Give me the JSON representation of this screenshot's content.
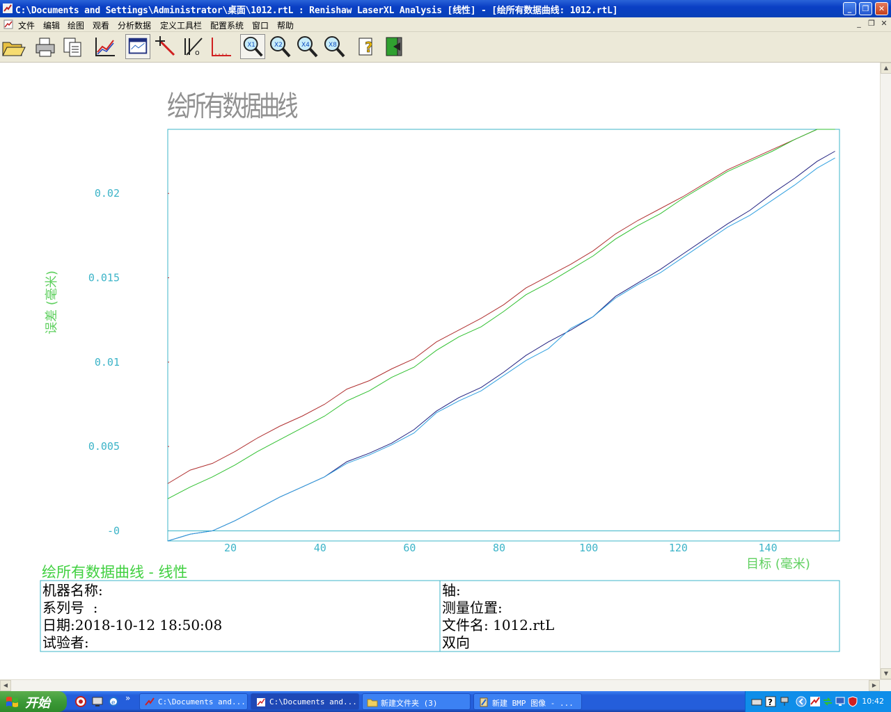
{
  "window": {
    "title": "C:\\Documents and Settings\\Administrator\\桌面\\1012.rtL : Renishaw LaserXL Analysis [线性] - [绘所有数据曲线: 1012.rtL]",
    "minimize": "_",
    "maximize": "❐",
    "close": "✕"
  },
  "menu": {
    "items": [
      "文件",
      "编辑",
      "绘图",
      "观看",
      "分析数据",
      "定义工具栏",
      "配置系统",
      "窗口",
      "帮助"
    ],
    "mdi_min": "_",
    "mdi_restore": "❐",
    "mdi_close": "✕"
  },
  "toolbar": {
    "buttons": [
      "open-icon",
      "print-icon",
      "copy-icon",
      "plot-icon",
      "window-icon",
      "error-line-icon",
      "slope-icon",
      "axis-icon",
      "zoom-x1-icon",
      "zoom-x2-icon",
      "zoom-x4-icon",
      "zoom-x8-icon",
      "help-icon",
      "exit-icon"
    ],
    "zoom_labels": [
      "X1",
      "X2",
      "X4",
      "X8"
    ]
  },
  "chart_title": "绘所有数据曲线",
  "chart_data": {
    "type": "line",
    "ylabel": "误差 (毫米)",
    "xlabel": "目标 (毫米)",
    "ylim": [
      -0.0006,
      0.0238
    ],
    "xlim": [
      6,
      156
    ],
    "yticks": [
      {
        "v": 0.02,
        "label": "0.02"
      },
      {
        "v": 0.015,
        "label": "0.015"
      },
      {
        "v": 0.01,
        "label": "0.01"
      },
      {
        "v": 0.005,
        "label": "0.005"
      },
      {
        "v": 0.0,
        "label": "-0"
      }
    ],
    "xticks": [
      20,
      40,
      60,
      80,
      100,
      120,
      140
    ],
    "x": [
      6,
      11,
      16,
      21,
      26,
      31,
      36,
      41,
      46,
      51,
      56,
      61,
      66,
      71,
      76,
      81,
      86,
      91,
      96,
      101,
      106,
      111,
      116,
      121,
      126,
      131,
      136,
      141,
      146,
      151,
      155
    ],
    "series": [
      {
        "color": "#b03030",
        "values": [
          0.0028,
          0.0036,
          0.004,
          0.0047,
          0.0055,
          0.0062,
          0.0068,
          0.0075,
          0.0084,
          0.0089,
          0.0096,
          0.0102,
          0.0112,
          0.0119,
          0.0126,
          0.0134,
          0.0144,
          0.0151,
          0.0158,
          0.0166,
          0.0176,
          0.0184,
          0.0191,
          0.0198,
          0.0206,
          0.0214,
          0.022,
          0.0226,
          0.0232,
          0.0238,
          0.0238
        ]
      },
      {
        "color": "#30c030",
        "values": [
          0.0019,
          0.0026,
          0.0032,
          0.0039,
          0.0047,
          0.0054,
          0.0061,
          0.0068,
          0.0077,
          0.0083,
          0.0091,
          0.0097,
          0.0107,
          0.0115,
          0.0121,
          0.013,
          0.014,
          0.0147,
          0.0155,
          0.0163,
          0.0173,
          0.0181,
          0.0188,
          0.0197,
          0.0205,
          0.0213,
          0.0219,
          0.0225,
          0.0232,
          0.0238,
          0.0238
        ]
      },
      {
        "color": "#202080",
        "values": [
          -0.0006,
          -0.0002,
          0.0,
          0.0006,
          0.0013,
          0.002,
          0.0026,
          0.0032,
          0.0041,
          0.0046,
          0.0052,
          0.006,
          0.0071,
          0.0079,
          0.0085,
          0.0094,
          0.0104,
          0.0112,
          0.0119,
          0.0127,
          0.0139,
          0.0147,
          0.0155,
          0.0164,
          0.0173,
          0.0182,
          0.019,
          0.02,
          0.0209,
          0.0219,
          0.0225
        ]
      },
      {
        "color": "#30a0e0",
        "values": [
          -0.0006,
          -0.0002,
          0.0,
          0.0006,
          0.0013,
          0.002,
          0.0026,
          0.0032,
          0.004,
          0.0045,
          0.0051,
          0.0058,
          0.007,
          0.0077,
          0.0083,
          0.0092,
          0.0101,
          0.0108,
          0.012,
          0.0127,
          0.0138,
          0.0146,
          0.0153,
          0.0162,
          0.0171,
          0.018,
          0.0187,
          0.0196,
          0.0205,
          0.0215,
          0.0221
        ]
      }
    ]
  },
  "info": {
    "heading": "绘所有数据曲线 - 线性",
    "machine": "机器名称:",
    "serial": "系列号  :",
    "date": "日期:2018-10-12 18:50:08",
    "tester": "试验者:",
    "axis": "轴:",
    "position": "测量位置:",
    "file": "文件名: 1012.rtL",
    "direction": "双向"
  },
  "taskbar": {
    "start": "开始",
    "tasks": [
      "C:\\Documents and...",
      "C:\\Documents and...",
      "新建文件夹 (3)",
      "新建 BMP 图像 - ..."
    ],
    "clock": "10:42",
    "chevron": "»"
  },
  "colors": {
    "axis_text": "#3cb4c8",
    "label_green": "#60d060",
    "frame": "#3cb4c8",
    "heading_green": "#40d040",
    "tick_red": "#c03030"
  }
}
